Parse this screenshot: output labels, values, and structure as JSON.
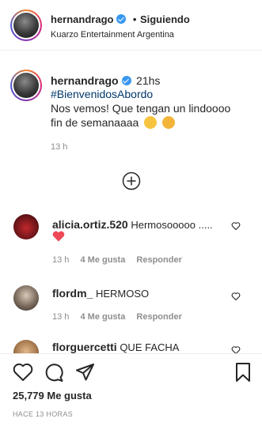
{
  "post_header": {
    "username": "hernandrago",
    "separator": "•",
    "follow_status": "Siguiendo",
    "subtitle": "Kuarzo Entertainment Argentina"
  },
  "caption": {
    "username": "hernandrago",
    "time": "21hs",
    "hashtag": "#BienvenidosAbordo",
    "text_line1": "Nos vemos! Que tengan un lindoooo",
    "text_line2": "fin de semanaaaa",
    "age": "13 h"
  },
  "load_more": {
    "icon": "plus-circle-icon"
  },
  "comments": [
    {
      "username": "alicia.ortiz.520",
      "text": "Hermosooooo .....",
      "age": "13 h",
      "likes": "4 Me gusta",
      "reply": "Responder",
      "has_heart_emoji": true
    },
    {
      "username": "flordm_",
      "text": "HERMOSO",
      "age": "13 h",
      "likes": "4 Me gusta",
      "reply": "Responder"
    },
    {
      "username": "florguercetti",
      "text": "QUE FACHA"
    }
  ],
  "actions": {
    "likes_count": "25,779 Me gusta",
    "posted_ago": "HACE 13 HORAS"
  },
  "colors": {
    "verified": "#3897f0",
    "heart": "#ed4956",
    "muted": "#8e8e8e",
    "hashtag": "#00376b"
  }
}
